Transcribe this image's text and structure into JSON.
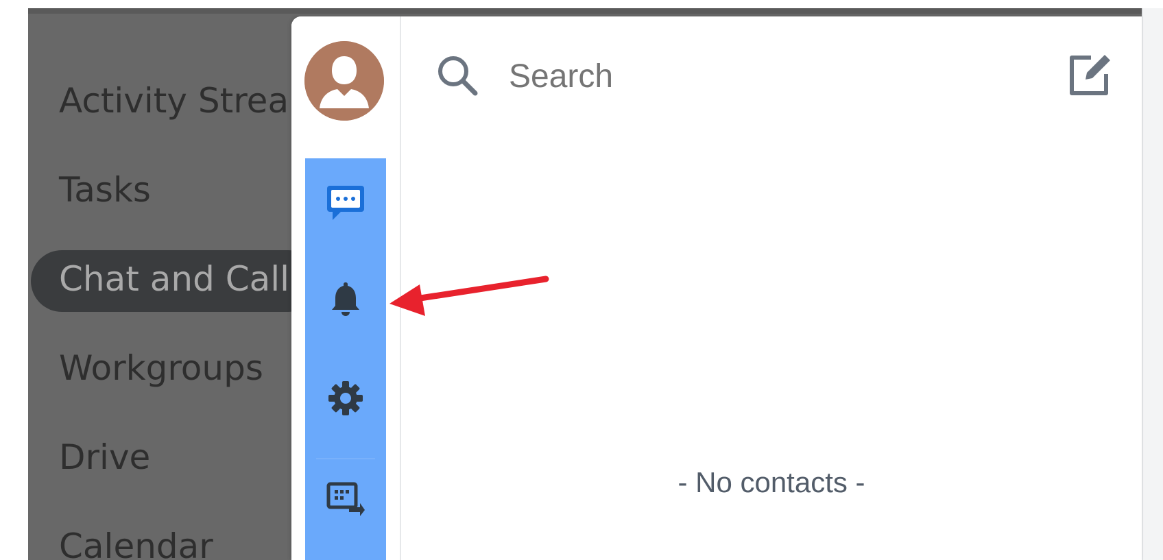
{
  "nav": {
    "items": [
      {
        "label": "Activity Strea"
      },
      {
        "label": "Tasks"
      },
      {
        "label": "Chat and Call"
      },
      {
        "label": "Workgroups"
      },
      {
        "label": "Drive"
      },
      {
        "label": "Calendar"
      }
    ],
    "active_index": 2
  },
  "messenger": {
    "search": {
      "placeholder": "Search"
    },
    "empty_state": "- No contacts -",
    "rail_icons": [
      "chat-icon",
      "bell-icon",
      "gear-icon",
      "screen-share-icon"
    ],
    "avatar_icon": "user-avatar-icon"
  },
  "colors": {
    "accent_blue": "#6aa9fb",
    "icon_dark_blue": "#1a6fd8",
    "avatar_brown": "#b07a60",
    "annotation_red": "#e8222d",
    "nav_dim": "#686868"
  }
}
